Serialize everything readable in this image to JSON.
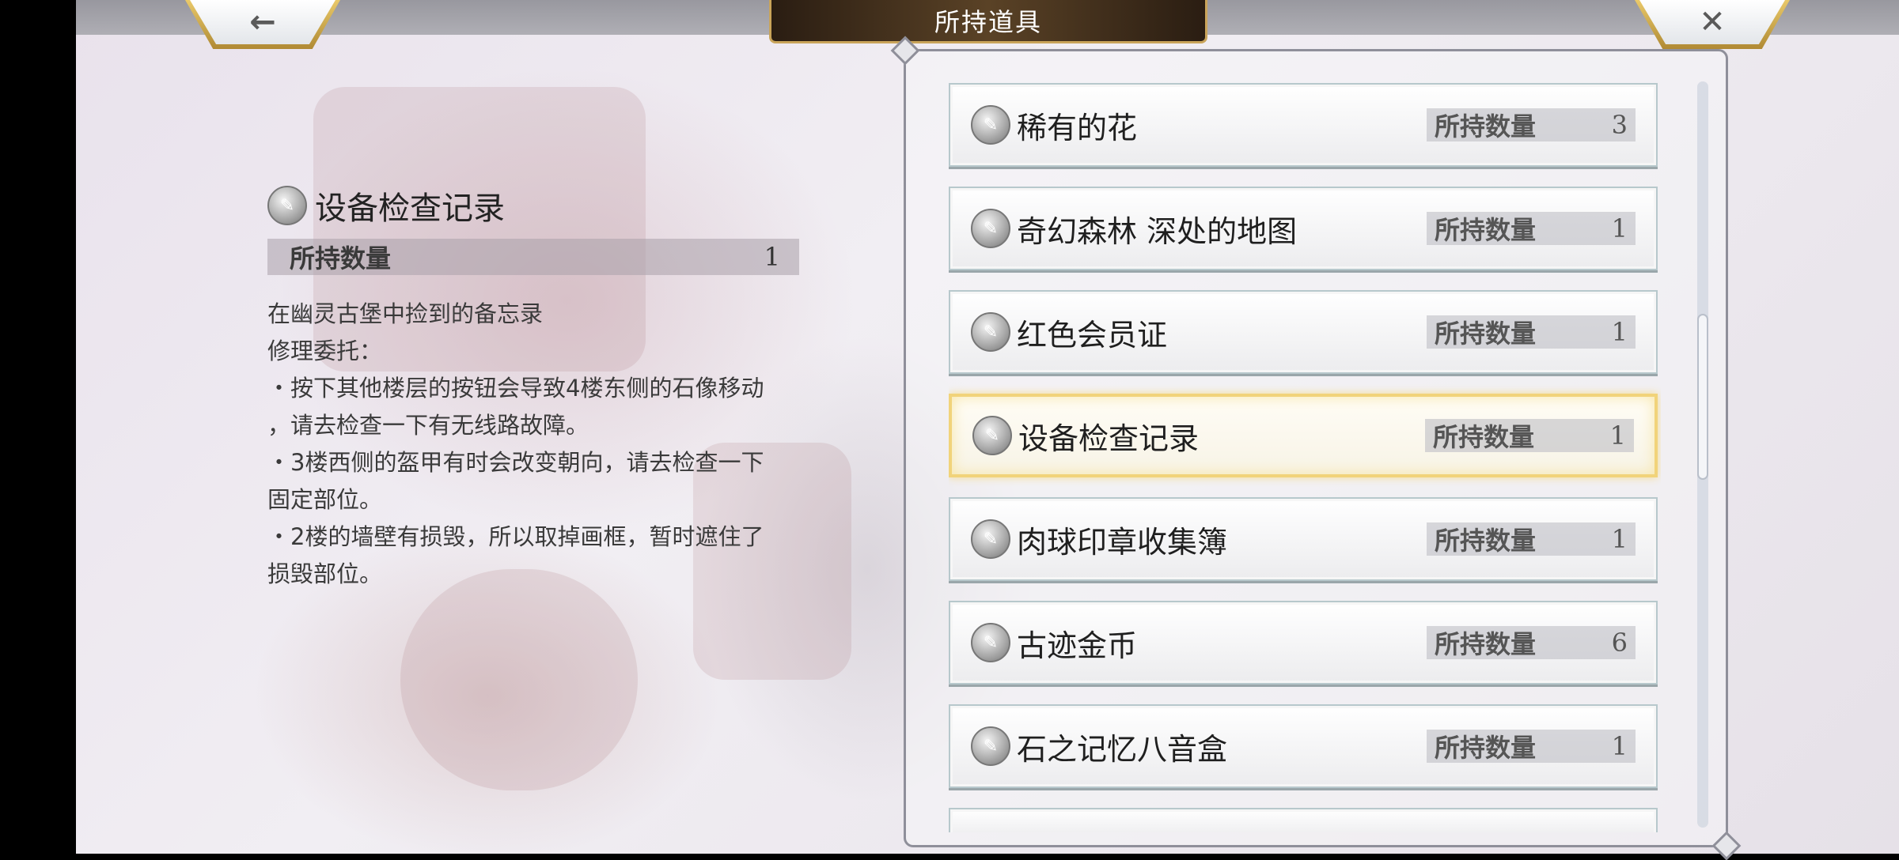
{
  "header": {
    "title": "所持道具",
    "back_icon": "←",
    "close_icon": "✕"
  },
  "detail": {
    "name": "设备检查记录",
    "quantity_label": "所持数量",
    "quantity": "1",
    "description": [
      "在幽灵古堡中捡到的备忘录",
      "修理委托：",
      "・按下其他楼层的按钮会导致4楼东侧的石像移动",
      "，请去检查一下有无线路故障。",
      "・3楼西侧的盔甲有时会改变朝向，请去检查一下",
      "固定部位。",
      "・2楼的墙壁有损毁，所以取掉画框，暂时遮住了",
      "损毁部位。"
    ]
  },
  "items": [
    {
      "name": "稀有的花",
      "quantity_label": "所持数量",
      "quantity": "3"
    },
    {
      "name": "奇幻森林 深处的地图",
      "quantity_label": "所持数量",
      "quantity": "1"
    },
    {
      "name": "红色会员证",
      "quantity_label": "所持数量",
      "quantity": "1"
    },
    {
      "name": "设备检查记录",
      "quantity_label": "所持数量",
      "quantity": "1"
    },
    {
      "name": "肉球印章收集簿",
      "quantity_label": "所持数量",
      "quantity": "1"
    },
    {
      "name": "古迹金币",
      "quantity_label": "所持数量",
      "quantity": "6"
    },
    {
      "name": "石之记忆八音盒",
      "quantity_label": "所持数量",
      "quantity": "1"
    }
  ],
  "icons": {
    "item_icon": "key-item-icon"
  },
  "colors": {
    "selected_border": "#f1d37a",
    "title_plate": "#3a2a18",
    "top_button_frame": "#d4b25a"
  }
}
